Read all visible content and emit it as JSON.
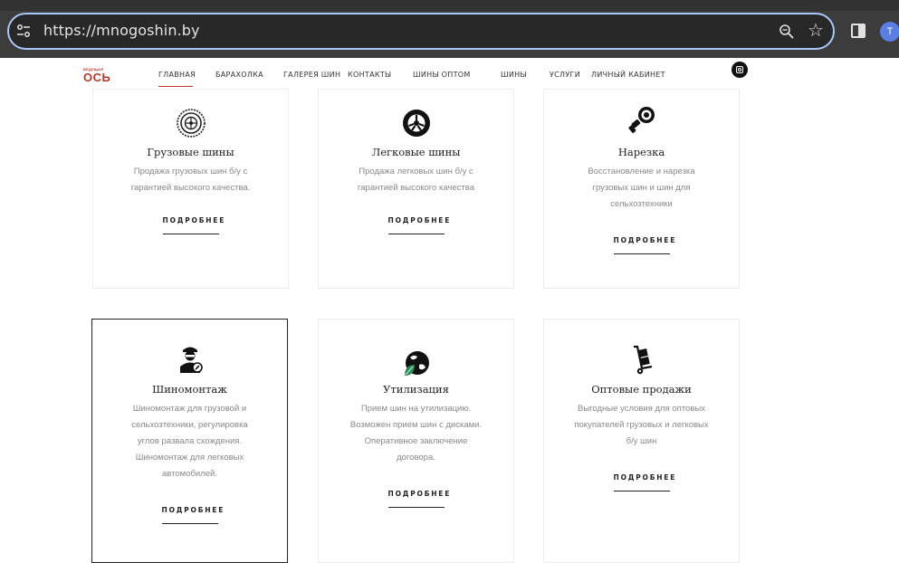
{
  "browser": {
    "url": "https://mnogoshin.by",
    "avatar_letter": "T",
    "icons": [
      "tune-icon",
      "zoom-icon",
      "star-icon",
      "side-panel-icon"
    ]
  },
  "site": {
    "logo_small": "ВЕДУЩАЯ",
    "logo_big": "ОСЬ",
    "nav": [
      "ГЛАВНАЯ",
      "БАРАХОЛКА",
      "ГАЛЕРЕЯ ШИН",
      "КОНТАКТЫ",
      "ШИНЫ ОПТОМ",
      "ШИНЫ",
      "УСЛУГИ",
      "ЛИЧНЫЙ КАБИНЕТ"
    ],
    "active_nav": "ГЛАВНАЯ",
    "accent_color": "#c0392b"
  },
  "cards": [
    {
      "title": "Грузовые шины",
      "desc": [
        "Продажа грузовых шин б/у с",
        "гарантией высокого качества."
      ],
      "link": "ПОДРОБНЕЕ",
      "icon": "truck-tire-icon"
    },
    {
      "title": "Легковые шины",
      "desc": [
        "Продажа легковых шин б/у с",
        "гарантией высокого качества"
      ],
      "link": "ПОДРОБНЕЕ",
      "icon": "car-tire-icon"
    },
    {
      "title": "Нарезка",
      "desc": [
        "Восстановление и нарезка",
        "грузовых шин и шин для",
        "сельхозтехники"
      ],
      "link": "ПОДРОБНЕЕ",
      "icon": "regrooving-tool-icon"
    },
    {
      "title": "Шиномонтаж",
      "desc": [
        "Шиномонтаж для грузовой и",
        "сельхозтехники, регулировка",
        "углов развала схождения.",
        "Шиномонтаж для легковых",
        "автомобилей."
      ],
      "link": "ПОДРОБНЕЕ",
      "icon": "mechanic-icon"
    },
    {
      "title": "Утилизация",
      "desc": [
        "Прием шин на утилизацию.",
        "Возможен прием шин с дисками.",
        "Оперативное заключение",
        "договора."
      ],
      "link": "ПОДРОБНЕЕ",
      "icon": "eco-globe-icon"
    },
    {
      "title": "Оптовые продажи",
      "desc": [
        "Выгодные условия для оптовых",
        "покупателей грузовых и легковых",
        "б/у шин"
      ],
      "link": "ПОДРОБНЕЕ",
      "icon": "hand-truck-icon"
    }
  ]
}
